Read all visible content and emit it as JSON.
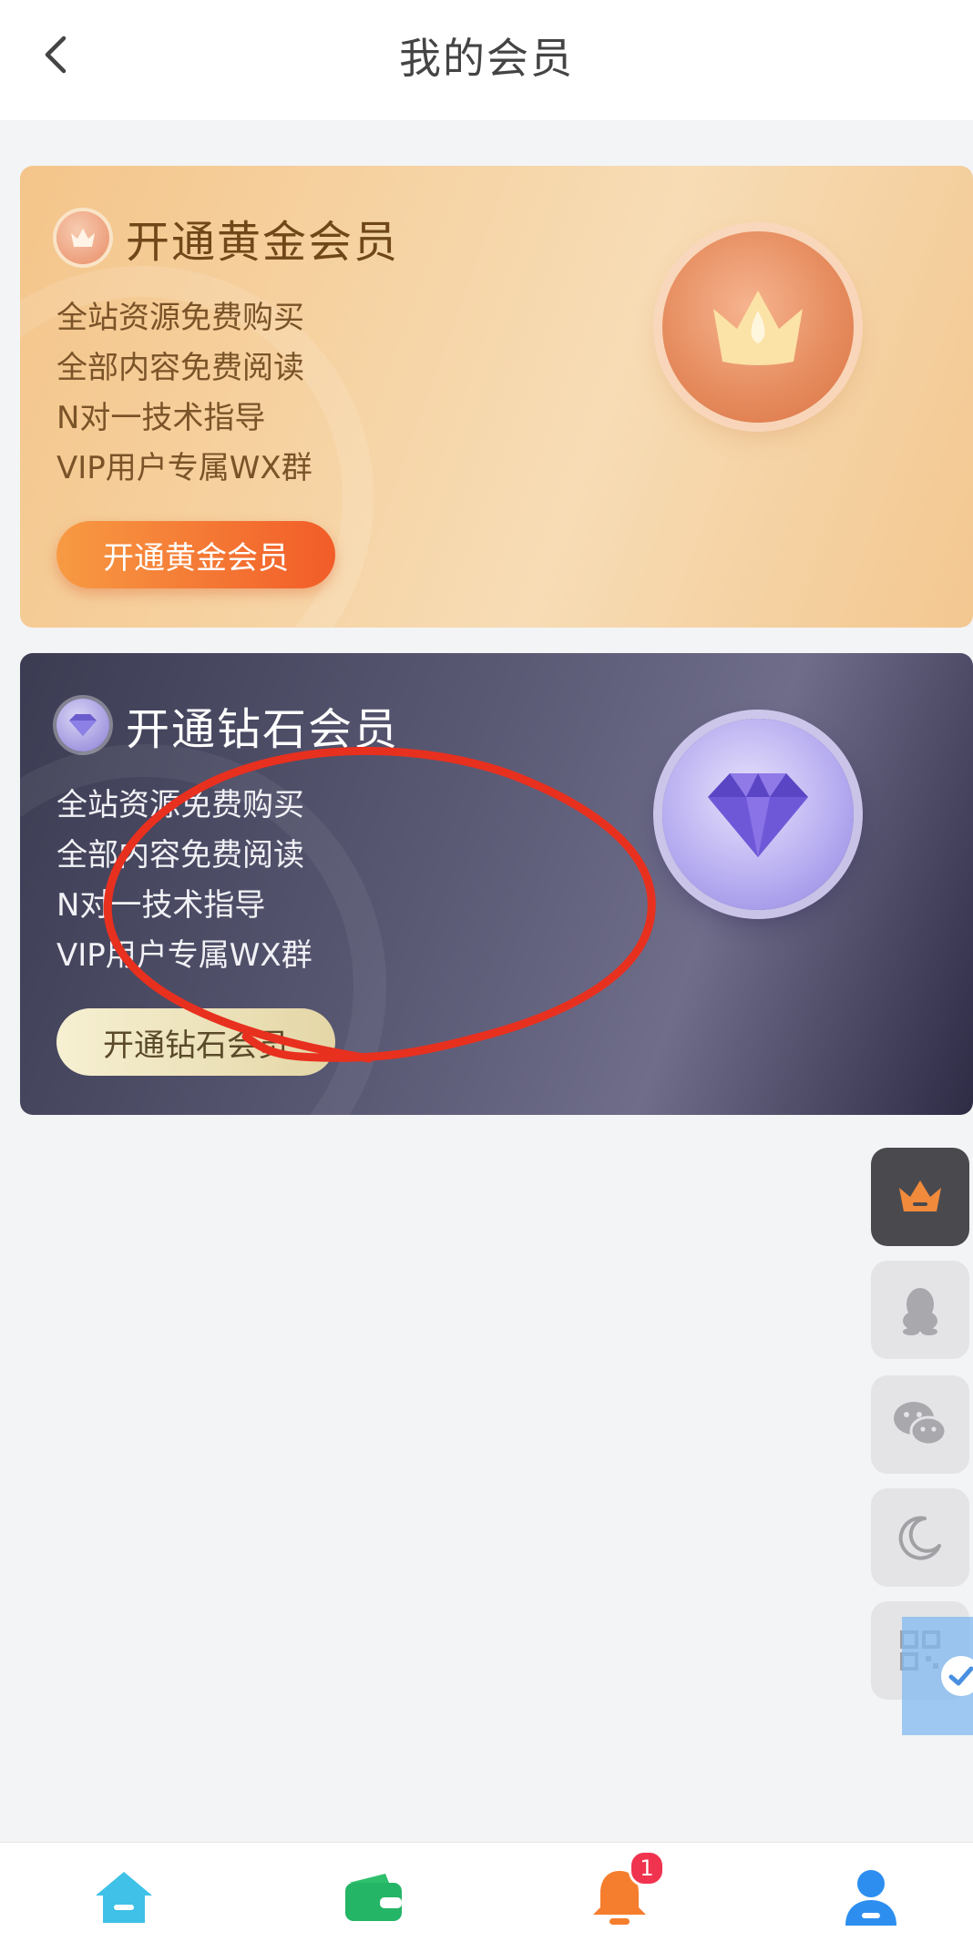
{
  "header": {
    "title": "我的会员"
  },
  "gold_card": {
    "title": "开通黄金会员",
    "features": [
      "全站资源免费购买",
      "全部内容免费阅读",
      "N对一技术指导",
      "VIP用户专属WX群"
    ],
    "cta": "开通黄金会员"
  },
  "diamond_card": {
    "title": "开通钻石会员",
    "features": [
      "全站资源免费购买",
      "全部内容免费阅读",
      "N对一技术指导",
      "VIP用户专属WX群"
    ],
    "cta": "开通钻石会员"
  },
  "side_buttons": [
    "crown-icon",
    "qq-icon",
    "wechat-icon",
    "moon-icon",
    "qrcode-icon"
  ],
  "bottom_nav": {
    "items": [
      "home-icon",
      "wallet-icon",
      "bell-icon",
      "user-icon"
    ],
    "notification_count": "1"
  },
  "colors": {
    "gold_accent": "#f25c28",
    "diamond_accent": "#8f84de",
    "annotation": "#e8301f"
  }
}
